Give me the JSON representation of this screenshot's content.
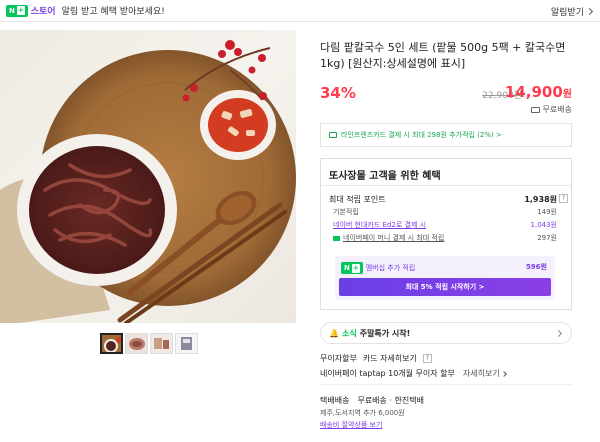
{
  "topbar": {
    "badge_n": "N",
    "badge_plus": "+",
    "store": "스토어",
    "message": "알림 받고 혜택 받아보세요!",
    "right_link": "알림받기"
  },
  "product": {
    "title": "다림 팥칼국수 5인 세트 (팥물 500g 5팩 + 칼국수면 1kg) [원산지:상세설명에 표시]",
    "discount": "34%",
    "original_price": "22,900원",
    "sale_price": "14,900",
    "sale_unit": "원",
    "shipping": "무료배송"
  },
  "line_promo": "라인프렌즈카드 결제 시 최대 298원 추가적립 (2%) >",
  "benefit": {
    "heading": "또사장몰 고객을 위한 혜택",
    "max_points_label": "최대 적립 포인트",
    "max_points_value": "1,938원",
    "q": "?",
    "basic_label": "기본적립",
    "basic_value": "149원",
    "card_label": "네이버 현대카드 Ed2로 결제 시",
    "card_value": "1,043원",
    "npay_label": "네이버페이 머니 결제 시 최대 적립",
    "npay_value": "297원",
    "membership_label": "멤버십 추가 적립",
    "membership_value": "596원",
    "membership_button": "최대 5% 적립 시작하기 >"
  },
  "alarm": {
    "title": "소식",
    "text": "주말특가 시작!"
  },
  "payment": {
    "installment_label": "무이자할부",
    "card_detail": "카드 자세히보기",
    "q": "?",
    "taptap_text": "네이버페이 taptap 10개월 무이자 할부",
    "taptap_detail": "자세히보기"
  },
  "delivery": {
    "label": "택배배송",
    "detail": "무료배송 · 한진택배",
    "extra": "제주,도서지역 추가 6,000원",
    "link": "배송비 절약상품 보기"
  },
  "colors": {
    "accent_red": "#ff3b50",
    "naver_green": "#03c75a",
    "purple": "#7b3fe4"
  }
}
